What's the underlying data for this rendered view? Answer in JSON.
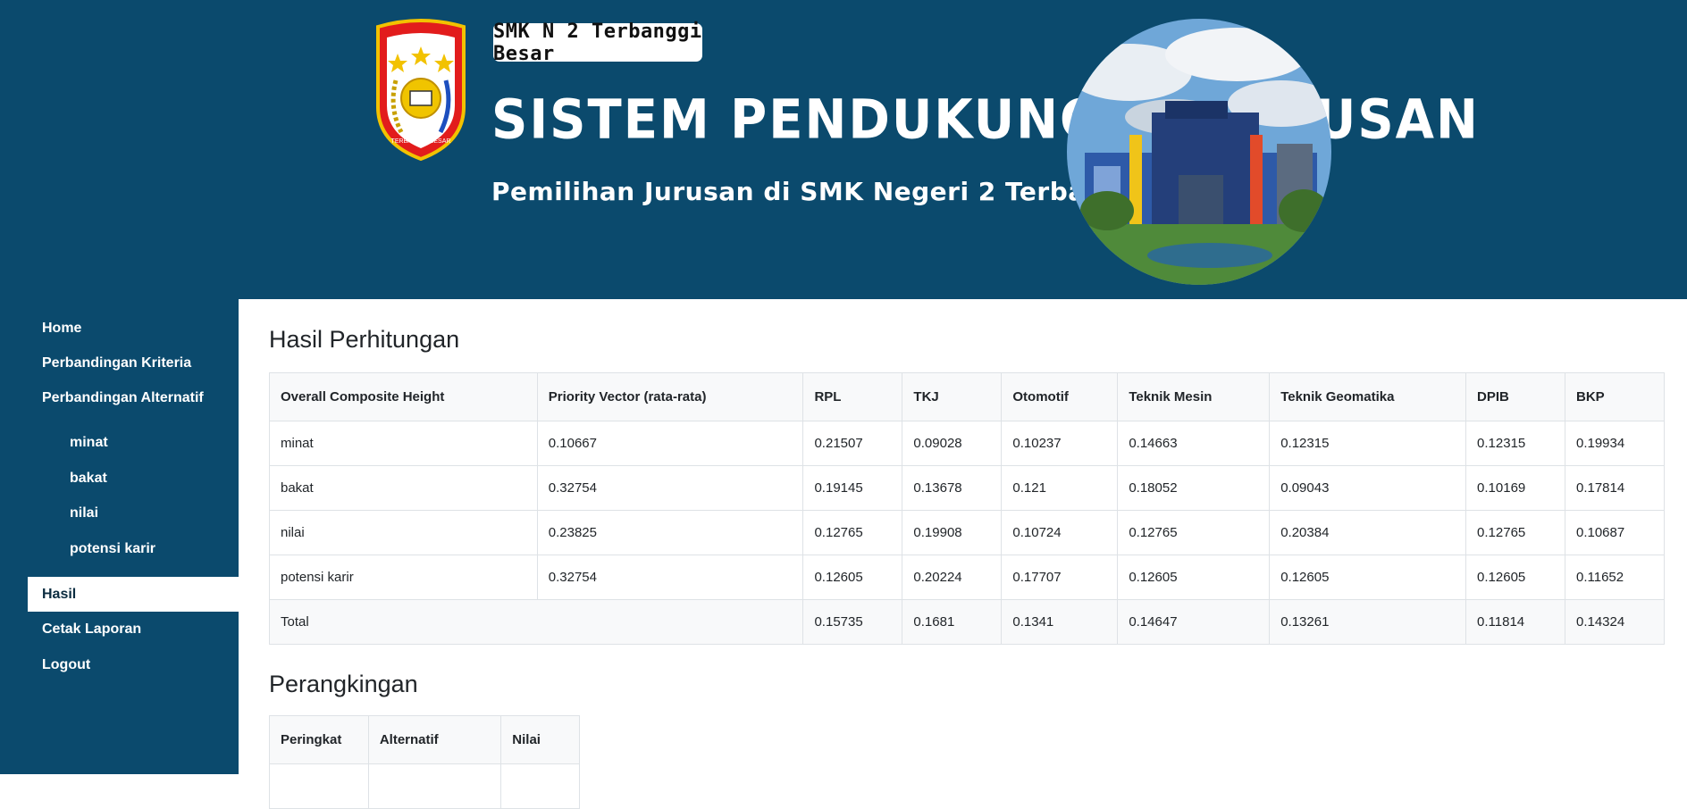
{
  "header": {
    "logo_text_top": "SMK N 2",
    "logo_text_bottom": "TERBANGGI BESAR",
    "school_tag": "SMK N 2 Terbanggi Besar",
    "title": "SISTEM PENDUKUNG KEPUTUSAN",
    "subtitle": "Pemilihan Jurusan di SMK Negeri 2 Terbanggi Besar",
    "colors": {
      "banner": "#0b4a6d"
    }
  },
  "sidebar": {
    "items": [
      {
        "label": "Home"
      },
      {
        "label": "Perbandingan Kriteria"
      },
      {
        "label": "Perbandingan Alternatif"
      },
      {
        "label": "minat"
      },
      {
        "label": "bakat"
      },
      {
        "label": "nilai"
      },
      {
        "label": "potensi karir"
      },
      {
        "label": "Hasil",
        "active": true
      },
      {
        "label": "Cetak Laporan"
      },
      {
        "label": "Logout"
      }
    ]
  },
  "main": {
    "hasil_title": "Hasil Perhitungan",
    "hasil_table": {
      "headers": [
        "Overall Composite Height",
        "Priority Vector (rata-rata)",
        "RPL",
        "TKJ",
        "Otomotif",
        "Teknik Mesin",
        "Teknik Geomatika",
        "DPIB",
        "BKP"
      ],
      "rows": [
        [
          "minat",
          "0.10667",
          "0.21507",
          "0.09028",
          "0.10237",
          "0.14663",
          "0.12315",
          "0.12315",
          "0.19934"
        ],
        [
          "bakat",
          "0.32754",
          "0.19145",
          "0.13678",
          "0.121",
          "0.18052",
          "0.09043",
          "0.10169",
          "0.17814"
        ],
        [
          "nilai",
          "0.23825",
          "0.12765",
          "0.19908",
          "0.10724",
          "0.12765",
          "0.20384",
          "0.12765",
          "0.10687"
        ],
        [
          "potensi karir",
          "0.32754",
          "0.12605",
          "0.20224",
          "0.17707",
          "0.12605",
          "0.12605",
          "0.12605",
          "0.11652"
        ]
      ],
      "total": [
        "Total",
        "0.15735",
        "0.1681",
        "0.1341",
        "0.14647",
        "0.13261",
        "0.11814",
        "0.14324"
      ]
    },
    "ranking_title": "Perangkingan",
    "ranking_table": {
      "headers": [
        "Peringkat",
        "Alternatif",
        "Nilai"
      ]
    }
  }
}
